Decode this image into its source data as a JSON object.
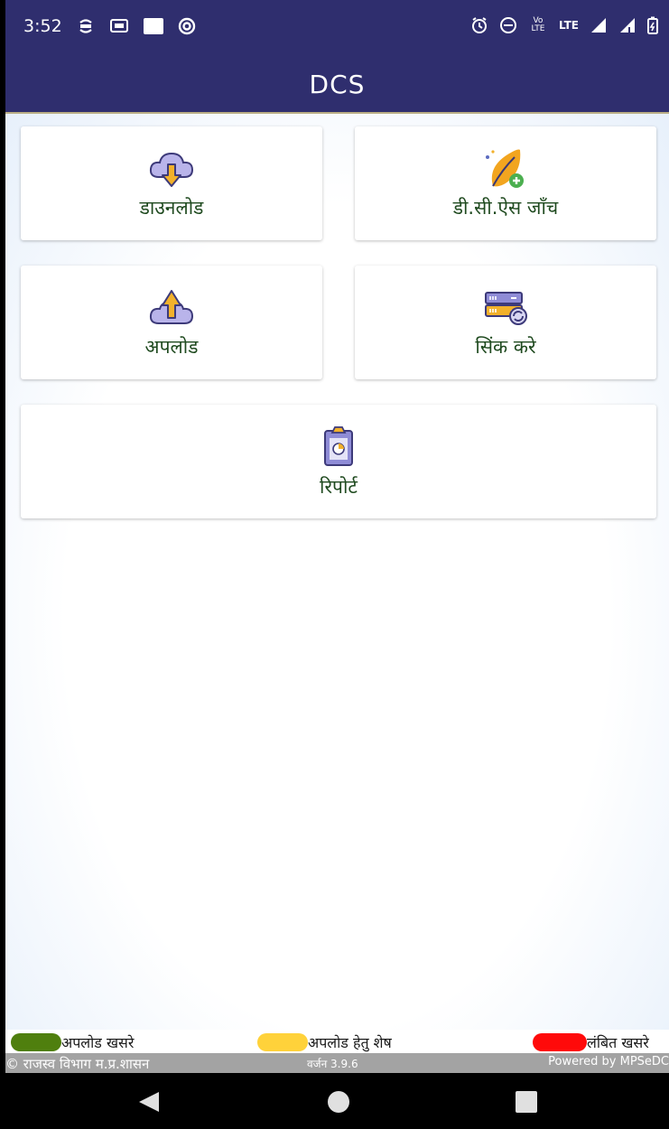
{
  "status_bar": {
    "time": "3:52",
    "icons_left": [
      "sync-icon",
      "cast-icon",
      "square-icon",
      "swirl-icon"
    ],
    "icons_right": [
      "alarm-icon",
      "dnd-icon",
      "volte-icon",
      "lte-signal-icon",
      "signal-icon",
      "battery-icon"
    ],
    "volte_text": "Vo LTE",
    "lte_text": "LTE"
  },
  "app_bar": {
    "title": "DCS",
    "color": "#2f2e6e"
  },
  "tiles": {
    "download": {
      "label": "डाउनलोड",
      "icon": "cloud-download-icon"
    },
    "dcs_check": {
      "label": "डी.सी.ऐस जाँच",
      "icon": "leaf-check-icon"
    },
    "upload": {
      "label": "अपलोड",
      "icon": "cloud-upload-icon"
    },
    "sync": {
      "label": "सिंक करे",
      "icon": "server-sync-icon"
    },
    "report": {
      "label": "रिपोर्ट",
      "icon": "clipboard-chart-icon"
    }
  },
  "legend": {
    "uploaded": {
      "label": "अपलोड खसरे",
      "color": "#4f7f0e"
    },
    "pending_upload": {
      "label": "अपलोड हेतु शेष",
      "color": "#ffd23a"
    },
    "pending": {
      "label": "लंबित खसरे",
      "color": "#ff0a0a"
    }
  },
  "footer": {
    "copyright": "© राजस्व विभाग म.प्र.शासन",
    "version": "वर्जन 3.9.6",
    "powered_by": "Powered by MPSeDC"
  },
  "nav": {
    "back": "back-icon",
    "home": "home-icon",
    "recents": "recents-icon"
  }
}
